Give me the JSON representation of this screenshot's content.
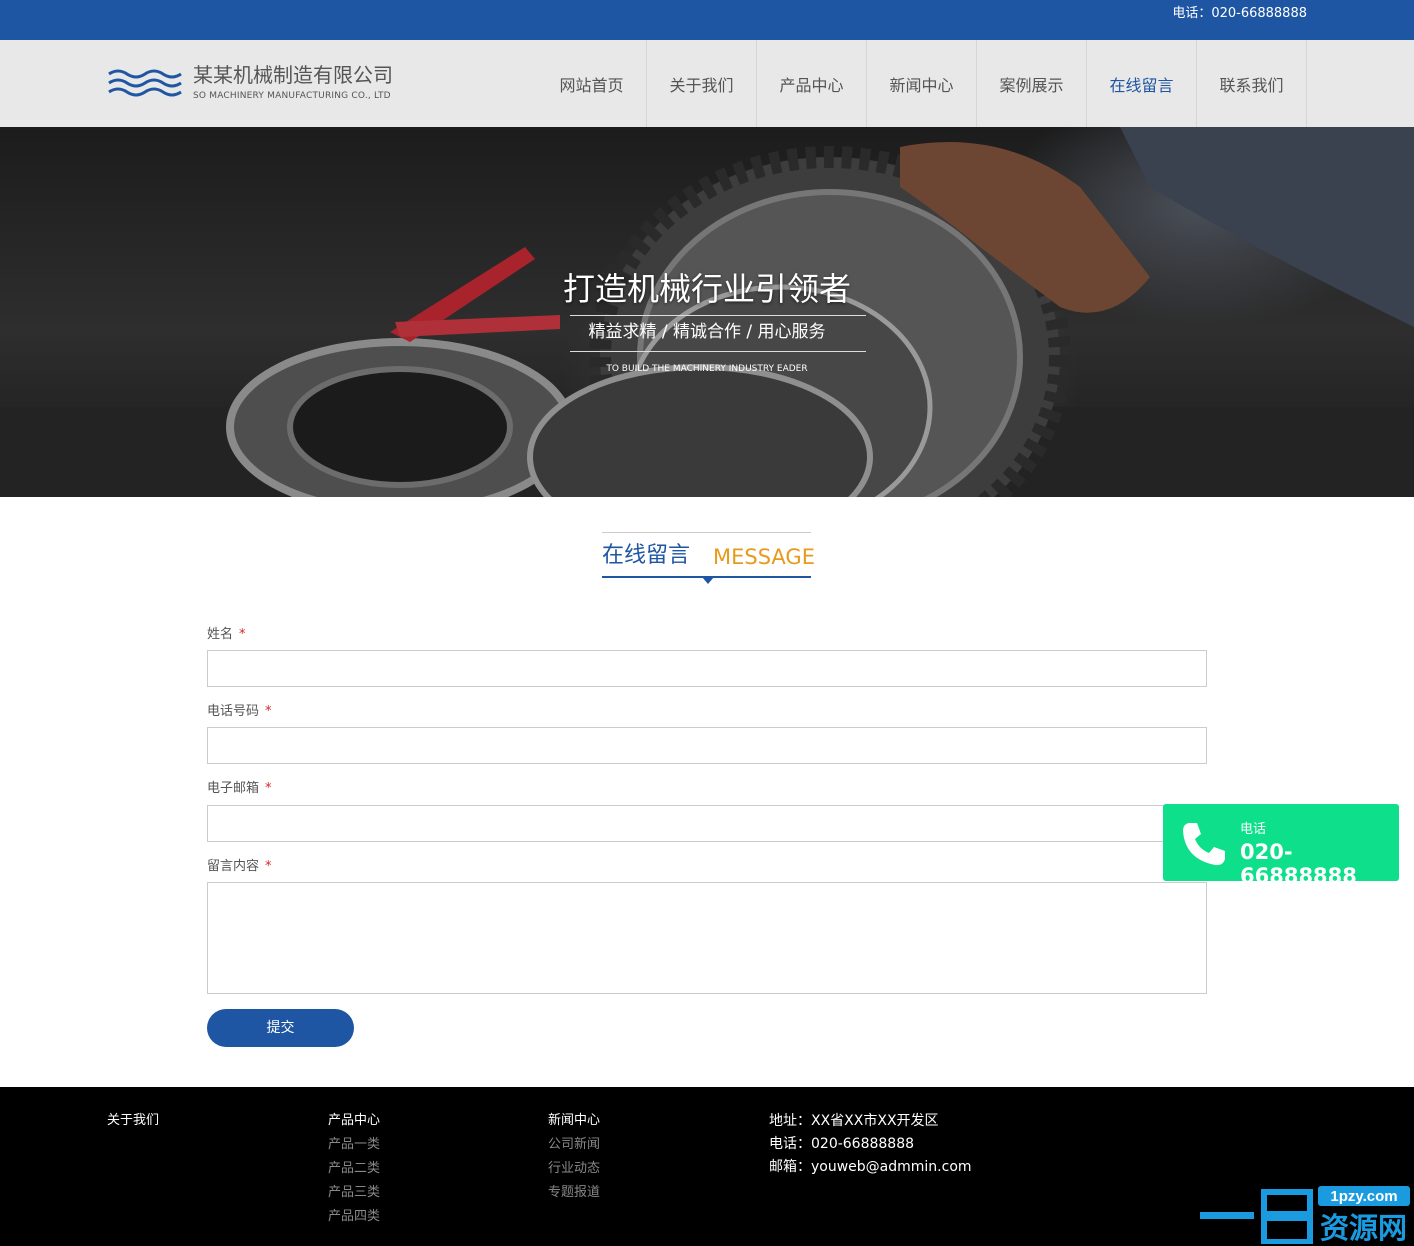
{
  "topbar": {
    "phone": "电话：020-66888888"
  },
  "logo": {
    "name": "某某机械制造有限公司",
    "en": "SO MACHINERY MANUFACTURING CO., LTD"
  },
  "nav": [
    {
      "label": "网站首页",
      "active": false
    },
    {
      "label": "关于我们",
      "active": false
    },
    {
      "label": "产品中心",
      "active": false
    },
    {
      "label": "新闻中心",
      "active": false
    },
    {
      "label": "案例展示",
      "active": false
    },
    {
      "label": "在线留言",
      "active": true
    },
    {
      "label": "联系我们",
      "active": false
    }
  ],
  "banner": {
    "slogan": "打造机械行业引领者",
    "sub": "精益求精 / 精诚合作 / 用心服务",
    "en": "TO BUILD THE MACHINERY INDUSTRY EADER"
  },
  "section": {
    "cn": "在线留言",
    "en": "MESSAGE"
  },
  "form": {
    "name_label": "姓名",
    "phone_label": "电话号码",
    "email_label": "电子邮箱",
    "message_label": "留言内容",
    "required_mark": "*",
    "submit": "提交"
  },
  "float_phone": {
    "label": "电话",
    "number": "020-66888888"
  },
  "footer": {
    "about": "关于我们",
    "products": {
      "title": "产品中心",
      "items": [
        "产品一类",
        "产品二类",
        "产品三类",
        "产品四类"
      ]
    },
    "news": {
      "title": "新闻中心",
      "items": [
        "公司新闻",
        "行业动态",
        "专题报道"
      ]
    },
    "contact": {
      "address": "地址：XX省XX市XX开发区",
      "phone": "电话：020-66888888",
      "email": "邮箱：youweb@admmin.com"
    }
  },
  "watermark": {
    "site": "1pzy.com",
    "text": "资源网",
    "prefix": "一品"
  },
  "colors": {
    "primary": "#1f56a3",
    "accent": "#e89a1c",
    "float": "#0ddf8a",
    "required": "#dd2222"
  }
}
